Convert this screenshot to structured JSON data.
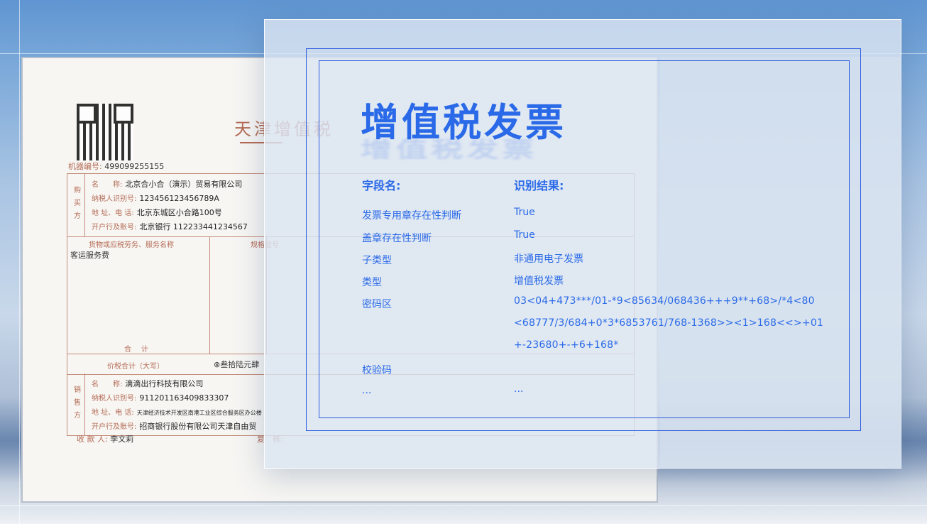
{
  "invoice": {
    "title": "天津增值税",
    "machine_label": "机器编号:",
    "machine_no": "499099255155",
    "buyer_side": "购买方",
    "buyer_name_label": "名　　称:",
    "buyer_name": "北京合小合（演示）贸易有限公司",
    "buyer_tax_label": "纳税人识别号:",
    "buyer_tax": "123456123456789A",
    "buyer_addr_label": "地 址、电 话:",
    "buyer_addr": "北京东城区小合路100号",
    "buyer_bank_label": "开户行及账号:",
    "buyer_bank": "北京银行 112233441234567",
    "goods_header": "货物或应税劳务、服务名称",
    "spec_header": "规格型号",
    "goods_item": "客运服务费",
    "total_label": "合计",
    "tax_total_label": "价税合计（大写）",
    "tax_total_value": "⊗叁拾陆元肆",
    "seller_side": "销售方",
    "seller_name_label": "名　　称:",
    "seller_name": "滴滴出行科技有限公司",
    "seller_tax_label": "纳税人识别号:",
    "seller_tax": "911201163409833307",
    "seller_addr_label": "地 址、电 话:",
    "seller_addr": "天津经济技术开发区南港工业区综合服务区办公楼",
    "seller_bank_label": "开户行及账号:",
    "seller_bank": "招商银行股份有限公司天津自由贸",
    "payee_label": "收 款 人:",
    "payee": "李文莉",
    "reviewer_label": "复　核:"
  },
  "panel": {
    "title": "增值税发票",
    "field_header": "字段名:",
    "result_header": "识别结果:",
    "rows": [
      {
        "field": "发票专用章存在性判断",
        "value": "True"
      },
      {
        "field": "盖章存在性判断",
        "value": "True"
      },
      {
        "field": "子类型",
        "value": "非通用电子发票"
      },
      {
        "field": "类型",
        "value": "增值税发票"
      },
      {
        "field": "密码区",
        "value": "03<04+473***/01-*9<85634/068436+++9**+68>/*4<80"
      },
      {
        "field": "",
        "value": "<68777/3/684+0*3*6853761/768-1368>><1>168<<>+01"
      },
      {
        "field": "",
        "value": "+-23680+-+6+168*"
      },
      {
        "field": "校验码",
        "value": ""
      },
      {
        "field": "...",
        "value": "..."
      }
    ]
  },
  "colors": {
    "accent": "#2a6ae8",
    "frame": "#2f5de0",
    "invoice_red": "#b56b55"
  }
}
